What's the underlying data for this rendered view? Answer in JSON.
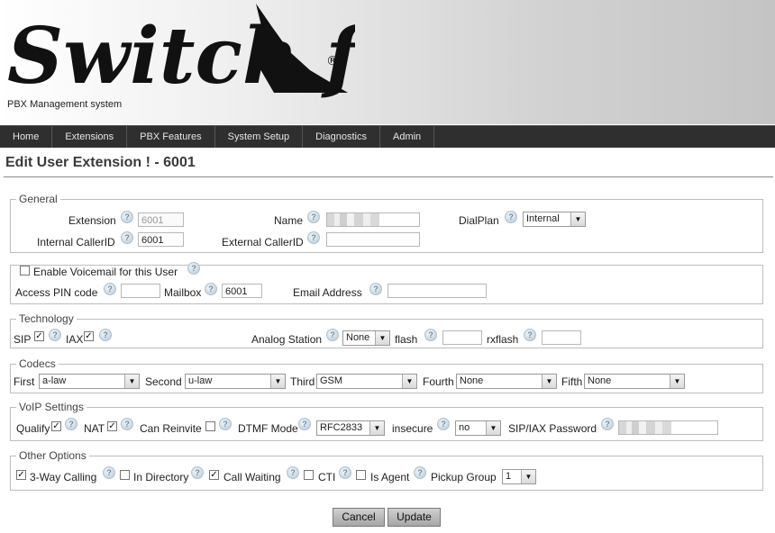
{
  "header": {
    "logo_text": "Switch fin",
    "tagline": "PBX Management system",
    "registered": "®"
  },
  "nav": [
    "Home",
    "Extensions",
    "PBX Features",
    "System Setup",
    "Diagnostics",
    "Admin"
  ],
  "page_title": "Edit User Extension ! - 6001",
  "general": {
    "legend": "General",
    "extension_label": "Extension",
    "extension_value": "6001",
    "name_label": "Name",
    "dialplan_label": "DialPlan",
    "dialplan_value": "Internal",
    "internal_callerid_label": "Internal CallerID",
    "internal_callerid_value": "6001",
    "external_callerid_label": "External CallerID"
  },
  "voicemail": {
    "legend": "Enable Voicemail for this User",
    "pin_label": "Access PIN code",
    "mailbox_label": "Mailbox",
    "mailbox_value": "6001",
    "email_label": "Email Address"
  },
  "technology": {
    "legend": "Technology",
    "sip_label": "SIP",
    "iax_label": "IAX",
    "analog_label": "Analog Station",
    "analog_value": "None",
    "flash_label": "flash",
    "rxflash_label": "rxflash"
  },
  "codecs": {
    "legend": "Codecs",
    "first_label": "First",
    "first_value": "a-law",
    "second_label": "Second",
    "second_value": "u-law",
    "third_label": "Third",
    "third_value": "GSM",
    "fourth_label": "Fourth",
    "fourth_value": "None",
    "fifth_label": "Fifth",
    "fifth_value": "None"
  },
  "voip": {
    "legend": "VoIP Settings",
    "qualify_label": "Qualify",
    "nat_label": "NAT",
    "reinvite_label": "Can Reinvite",
    "dtmf_label": "DTMF Mode",
    "dtmf_value": "RFC2833",
    "insecure_label": "insecure",
    "insecure_value": "no",
    "password_label": "SIP/IAX Password"
  },
  "other": {
    "legend": "Other Options",
    "threeway_label": "3-Way Calling",
    "directory_label": "In Directory",
    "callwaiting_label": "Call Waiting",
    "cti_label": "CTI",
    "agent_label": "Is Agent",
    "pickup_label": "Pickup Group",
    "pickup_value": "1"
  },
  "buttons": {
    "cancel": "Cancel",
    "update": "Update"
  },
  "icons": {
    "help": "help-icon",
    "checkmark": "✓",
    "dropdown": "▼"
  }
}
